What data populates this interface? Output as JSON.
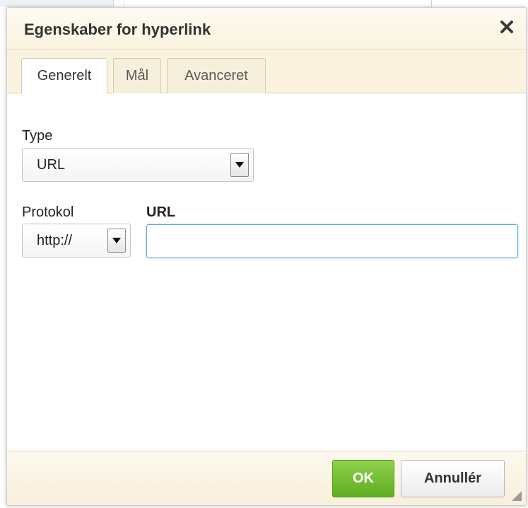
{
  "dialog": {
    "title": "Egenskaber for hyperlink",
    "close_icon": "close-icon"
  },
  "tabs": [
    {
      "label": "Generelt",
      "active": true
    },
    {
      "label": "Mål",
      "active": false
    },
    {
      "label": "Avanceret",
      "active": false
    }
  ],
  "form": {
    "type": {
      "label": "Type",
      "selected": "URL"
    },
    "protocol": {
      "label": "Protokol",
      "selected": "http://"
    },
    "url": {
      "label": "URL",
      "value": "",
      "placeholder": ""
    }
  },
  "footer": {
    "ok_label": "OK",
    "cancel_label": "Annullér"
  },
  "colors": {
    "ok_button": "#6cbb2e",
    "focus_border": "#59a7d8",
    "header_bg": "#fbf3df"
  }
}
